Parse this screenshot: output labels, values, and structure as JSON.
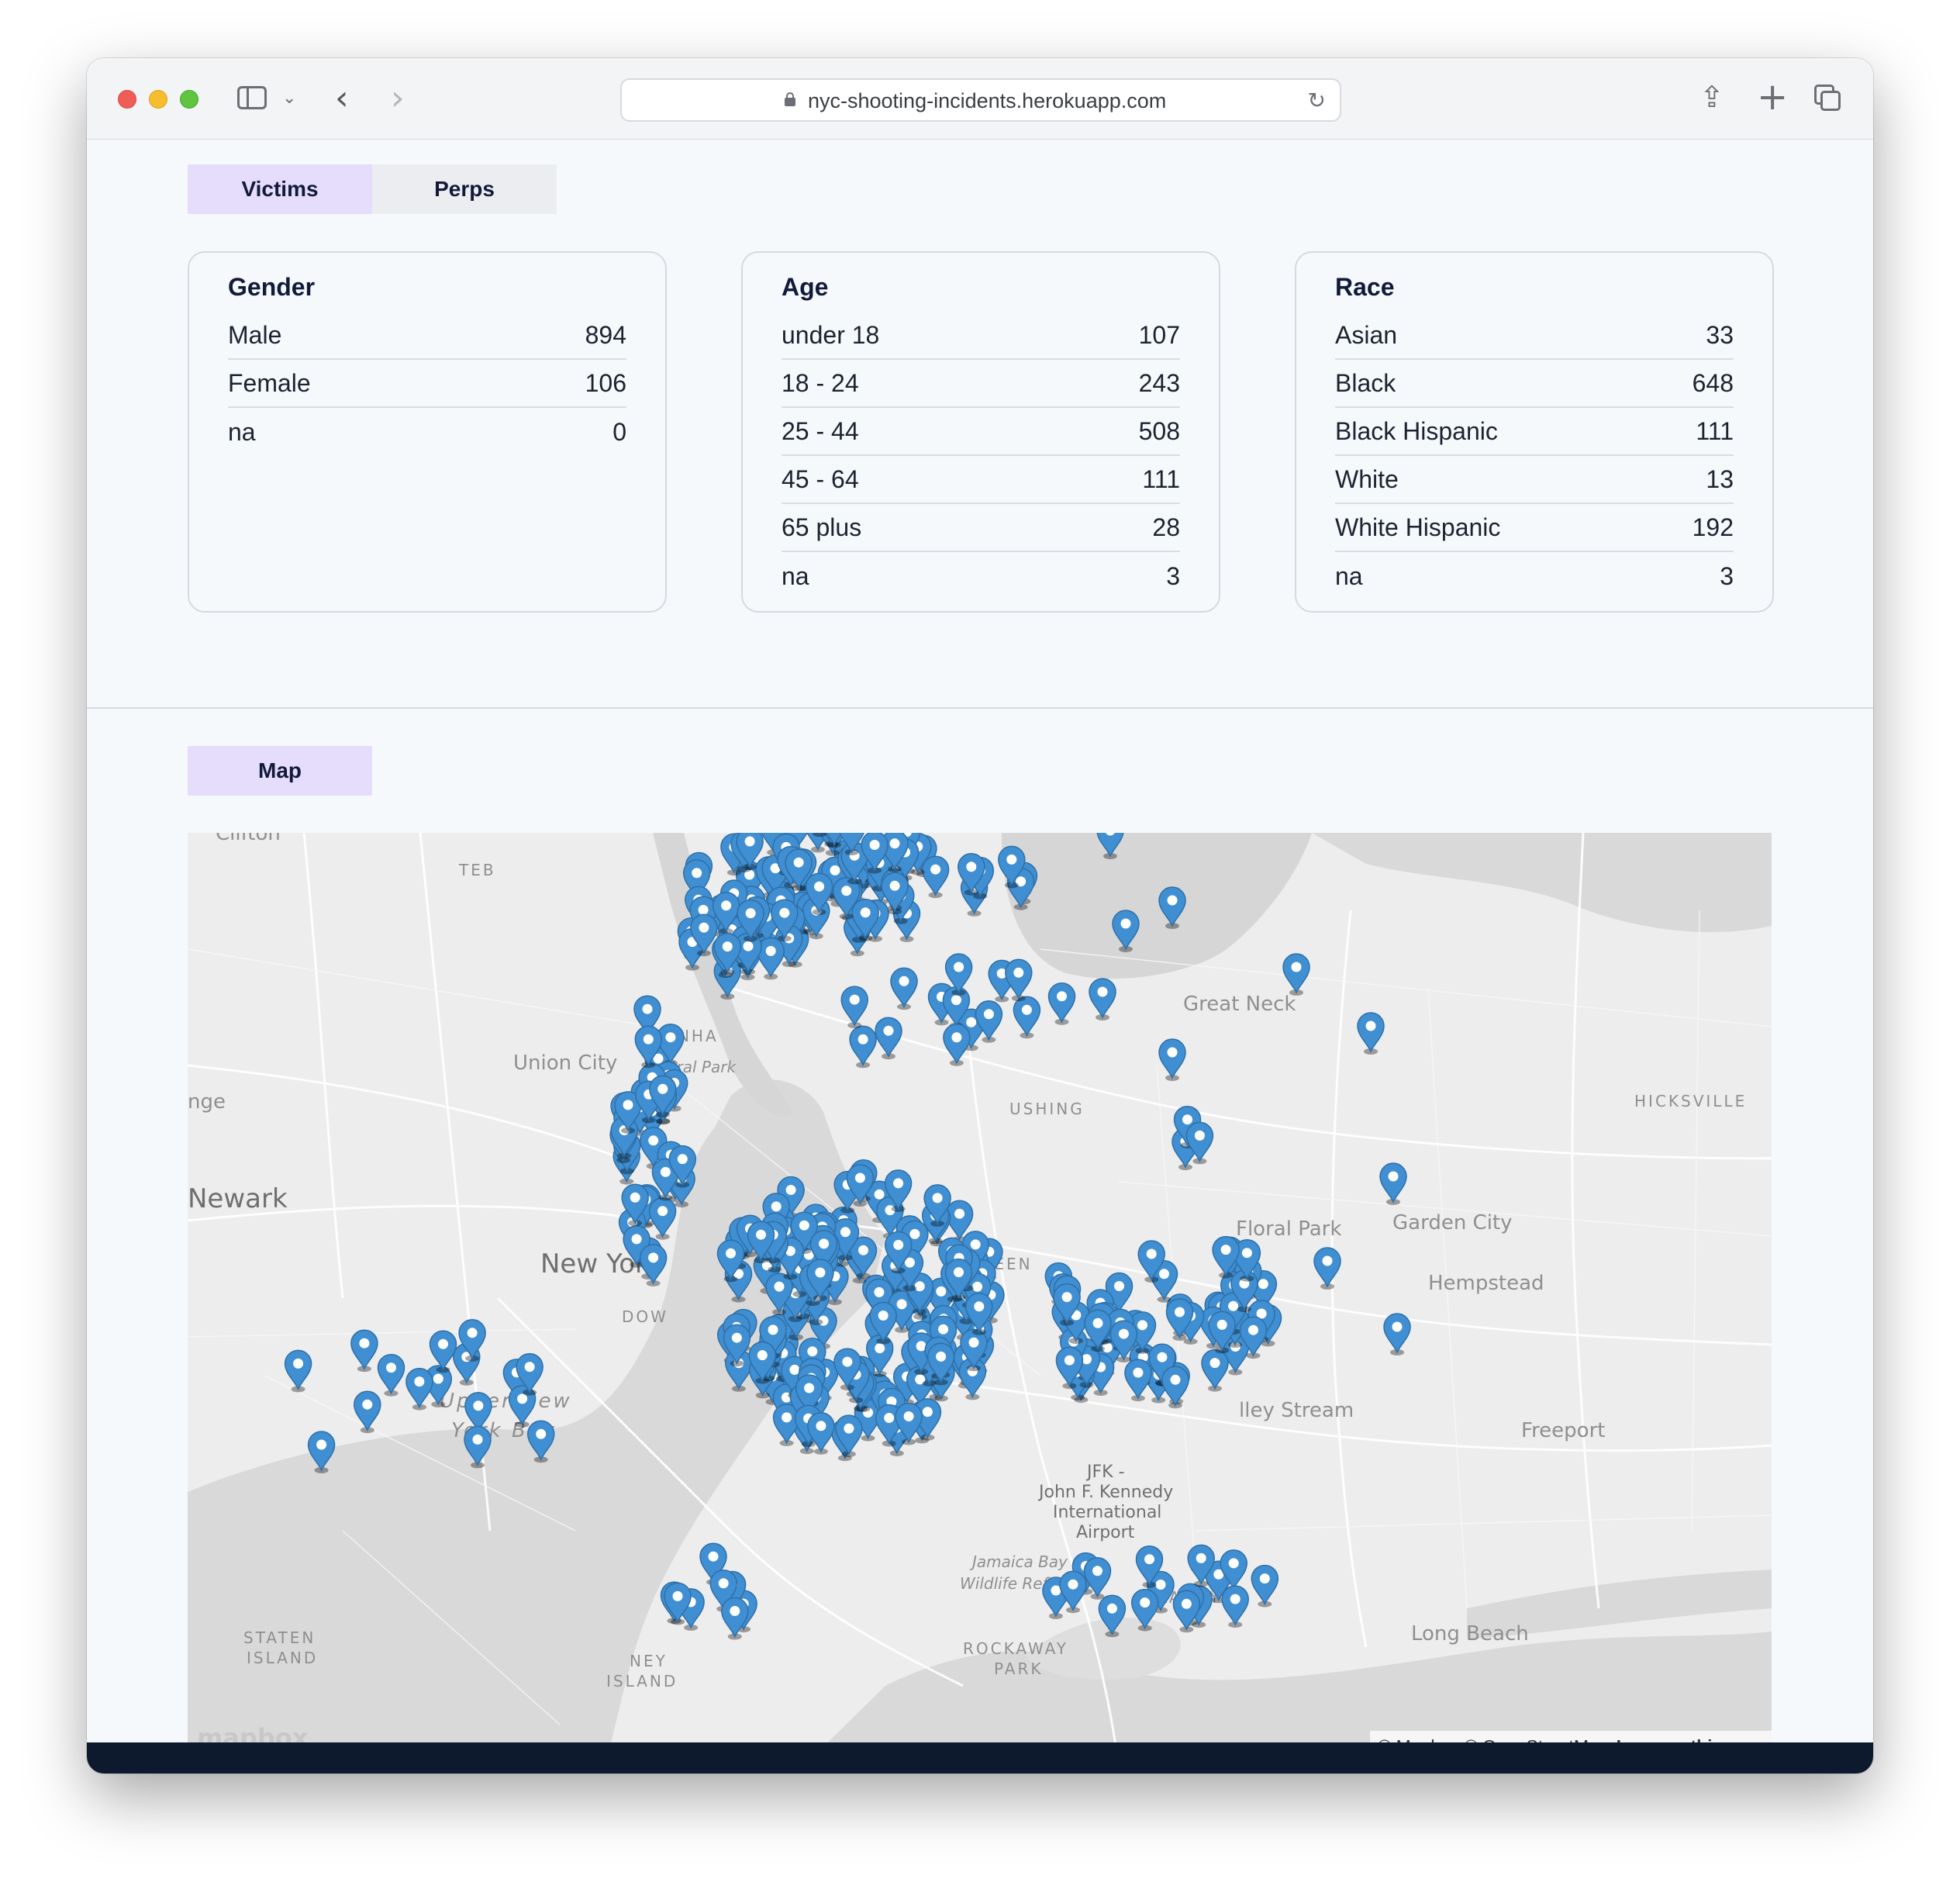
{
  "browser": {
    "url": "nyc-shooting-incidents.herokuapp.com"
  },
  "tabs": [
    {
      "label": "Victims",
      "active": true
    },
    {
      "label": "Perps",
      "active": false
    }
  ],
  "cards": {
    "gender": {
      "title": "Gender",
      "rows": [
        {
          "label": "Male",
          "value": "894"
        },
        {
          "label": "Female",
          "value": "106"
        },
        {
          "label": "na",
          "value": "0"
        }
      ]
    },
    "age": {
      "title": "Age",
      "rows": [
        {
          "label": "under 18",
          "value": "107"
        },
        {
          "label": "18 - 24",
          "value": "243"
        },
        {
          "label": "25 - 44",
          "value": "508"
        },
        {
          "label": "45 - 64",
          "value": "111"
        },
        {
          "label": "65 plus",
          "value": "28"
        },
        {
          "label": "na",
          "value": "3"
        }
      ]
    },
    "race": {
      "title": "Race",
      "rows": [
        {
          "label": "Asian",
          "value": "33"
        },
        {
          "label": "Black",
          "value": "648"
        },
        {
          "label": "Black Hispanic",
          "value": "111"
        },
        {
          "label": "White",
          "value": "13"
        },
        {
          "label": "White Hispanic",
          "value": "192"
        },
        {
          "label": "na",
          "value": "3"
        }
      ]
    }
  },
  "map_section": {
    "tab_label": "Map",
    "place_labels": {
      "clifton": "Clifton",
      "teb": "TEB",
      "union_city": "Union City",
      "manhattan": "MANHA",
      "central_park": "ntral Park",
      "ridge": "nge",
      "newark": "Newark",
      "new_york": "New York",
      "downtown": "DOW",
      "upper_bay_1": "Upper New",
      "upper_bay_2": "York Bay",
      "staten_island_1": "STATEN",
      "staten_island_2": "ISLAND",
      "coney_1": "NEY",
      "coney_2": "ISLAND",
      "flushing": "USHING",
      "queens": "QUEEN",
      "great_neck": "Great Neck",
      "hicksville": "HICKSVILLE",
      "floral_park": "Floral Park",
      "garden_city": "Garden City",
      "hempstead": "Hempstead",
      "valley_stream": "lley Stream",
      "freeport": "Freeport",
      "jfk_1": "JFK -",
      "jfk_2": "John F. Kennedy",
      "jfk_3": "International",
      "jfk_4": "Airport",
      "jamaica_bay_1": "Jamaica Bay",
      "jamaica_bay_2": "Wildlife Refuge",
      "rockaway_1": "ROCKAWAY",
      "rockaway_2": "PARK",
      "rockaway_east": "KAWAY",
      "long_beach": "Long Beach"
    },
    "logo": "mapbox",
    "attribution": "© Mapbox © OpenStreetMap",
    "improve_link": "Improve this map",
    "marker_color": "#3f8fd2"
  }
}
